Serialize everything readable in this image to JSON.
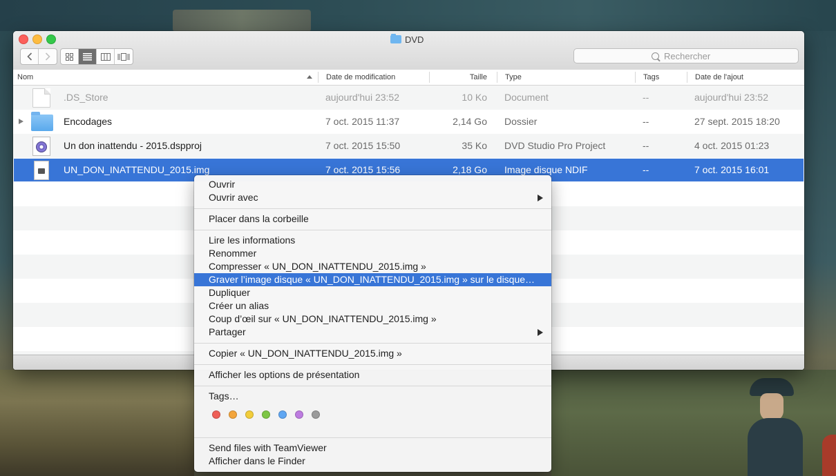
{
  "window": {
    "title": "DVD",
    "search_placeholder": "Rechercher"
  },
  "columns": {
    "name": "Nom",
    "date": "Date de modification",
    "size": "Taille",
    "type": "Type",
    "tags": "Tags",
    "added": "Date de l'ajout"
  },
  "files": [
    {
      "name": ".DS_Store",
      "date": "aujourd'hui 23:52",
      "size": "10 Ko",
      "type": "Document",
      "tags": "--",
      "added": "aujourd'hui 23:52"
    },
    {
      "name": "Encodages",
      "date": "7 oct. 2015 11:37",
      "size": "2,14 Go",
      "type": "Dossier",
      "tags": "--",
      "added": "27 sept. 2015 18:20"
    },
    {
      "name": "Un don inattendu - 2015.dspproj",
      "date": "7 oct. 2015 15:50",
      "size": "35 Ko",
      "type": "DVD Studio Pro Project",
      "tags": "--",
      "added": "4 oct. 2015 01:23"
    },
    {
      "name": "UN_DON_INATTENDU_2015.img",
      "date": "7 oct. 2015 15:56",
      "size": "2,18 Go",
      "type": "Image disque NDIF",
      "tags": "--",
      "added": "7 oct. 2015 16:01"
    }
  ],
  "menu": {
    "open": "Ouvrir",
    "open_with": "Ouvrir avec",
    "trash": "Placer dans la corbeille",
    "get_info": "Lire les informations",
    "rename": "Renommer",
    "compress": "Compresser « UN_DON_INATTENDU_2015.img »",
    "burn": "Graver l’image disque « UN_DON_INATTENDU_2015.img » sur le disque…",
    "duplicate": "Dupliquer",
    "alias": "Créer un alias",
    "quicklook": "Coup d’œil sur « UN_DON_INATTENDU_2015.img »",
    "share": "Partager",
    "copy": "Copier « UN_DON_INATTENDU_2015.img »",
    "view_options": "Afficher les options de présentation",
    "tags": "Tags…",
    "teamviewer": "Send files with TeamViewer",
    "reveal": "Afficher dans le Finder"
  },
  "tag_colors": [
    "#ee5f57",
    "#f3a53b",
    "#f2cd3b",
    "#7dc645",
    "#5fa6f2",
    "#bd7ce0",
    "#9b9b9b"
  ],
  "icons": {
    "back": "chevron-left-icon",
    "forward": "chevron-right-icon",
    "view_icons": "grid-icon",
    "view_list": "list-icon",
    "view_columns": "columns-icon",
    "view_coverflow": "coverflow-icon",
    "search": "search-icon"
  },
  "colors": {
    "selection": "#3875d7"
  }
}
